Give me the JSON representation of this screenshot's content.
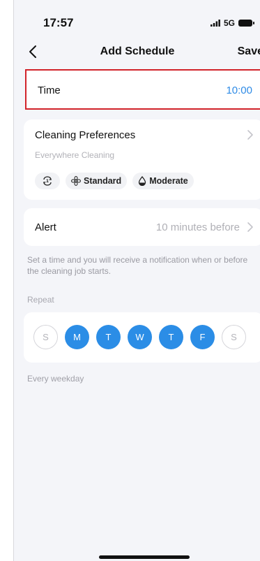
{
  "status": {
    "time": "17:57",
    "network": "5G"
  },
  "nav": {
    "title": "Add Schedule",
    "save_label": "Save"
  },
  "time_row": {
    "label": "Time",
    "value": "10:00"
  },
  "preferences": {
    "title": "Cleaning Preferences",
    "subtitle": "Everywhere Cleaning",
    "chips": [
      {
        "icon": "cleaning-times-icon",
        "label": ""
      },
      {
        "icon": "fan-icon",
        "label": "Standard"
      },
      {
        "icon": "water-drop-icon",
        "label": "Moderate"
      }
    ]
  },
  "alert": {
    "label": "Alert",
    "value": "10 minutes before"
  },
  "note": "Set a time and you will receive a notification when or before the cleaning job starts.",
  "repeat": {
    "label": "Repeat",
    "days": [
      {
        "letter": "S",
        "selected": false
      },
      {
        "letter": "M",
        "selected": true
      },
      {
        "letter": "T",
        "selected": true
      },
      {
        "letter": "W",
        "selected": true
      },
      {
        "letter": "T",
        "selected": true
      },
      {
        "letter": "F",
        "selected": true
      },
      {
        "letter": "S",
        "selected": false
      }
    ],
    "summary": "Every weekday"
  },
  "colors": {
    "accent": "#2b8de6",
    "highlight": "#d2232a",
    "time_value": "#2f8be6"
  }
}
